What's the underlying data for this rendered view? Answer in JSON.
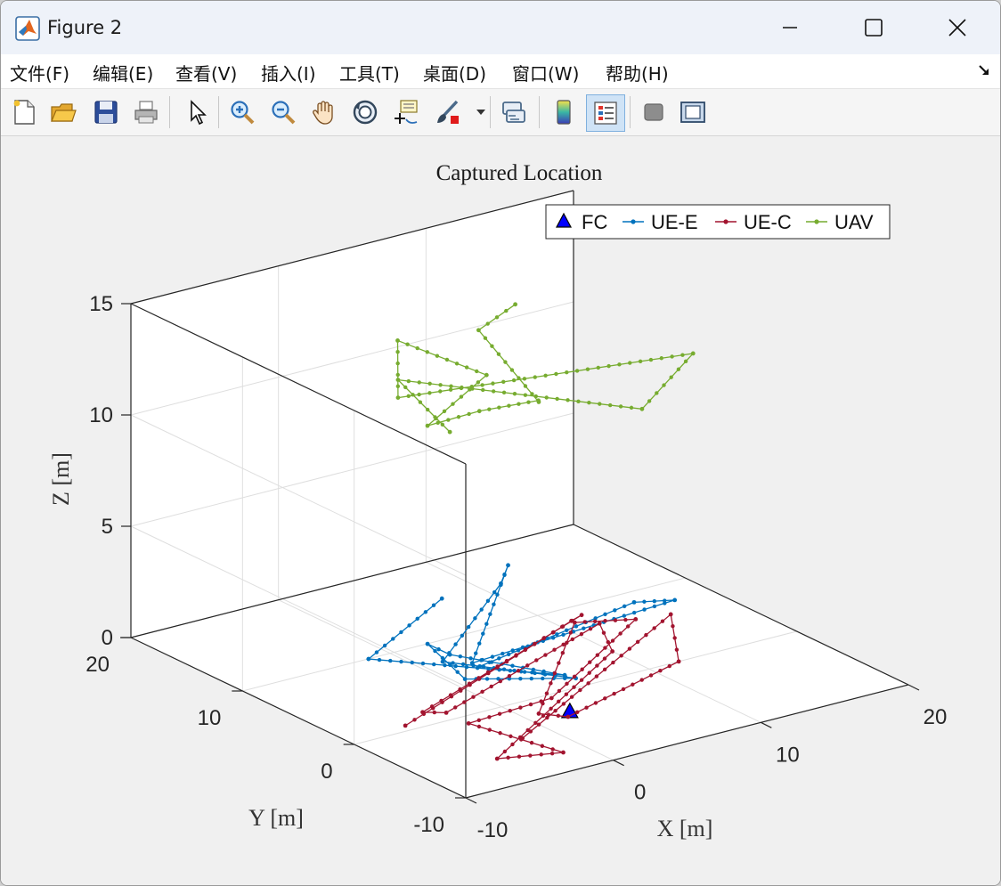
{
  "window": {
    "title": "Figure 2",
    "controls": [
      "minimize",
      "maximize",
      "close"
    ]
  },
  "menu": {
    "items": [
      "文件(F)",
      "编辑(E)",
      "查看(V)",
      "插入(I)",
      "工具(T)",
      "桌面(D)",
      "窗口(W)",
      "帮助(H)"
    ]
  },
  "toolbar": {
    "buttons": [
      "new-figure-icon",
      "open-icon",
      "save-icon",
      "print-icon",
      "pointer-icon",
      "zoom-in-icon",
      "zoom-out-icon",
      "pan-hand-icon",
      "rotate-3d-icon",
      "data-cursor-icon",
      "brush-icon",
      "link-plot-icon",
      "colorbar-icon",
      "legend-icon",
      "hide-plot-tools-icon",
      "show-plot-tools-icon"
    ],
    "active": "legend-icon"
  },
  "chart_data": {
    "type": "line",
    "projection": "3d",
    "title": "Captured Location",
    "xlabel": "X [m]",
    "ylabel": "Y [m]",
    "zlabel": "Z [m]",
    "xlim": [
      -10,
      20
    ],
    "ylim": [
      -10,
      20
    ],
    "zlim": [
      0,
      15
    ],
    "xticks": [
      -10,
      0,
      10,
      20
    ],
    "yticks": [
      -10,
      0,
      10,
      20
    ],
    "zticks": [
      0,
      5,
      10,
      15
    ],
    "grid": true,
    "legend_position": "top-right",
    "series": [
      {
        "name": "FC",
        "color": "#0000ff",
        "marker": "triangle",
        "line": false,
        "points": [
          [
            2.5,
            -2.8,
            0
          ]
        ]
      },
      {
        "name": "UE-E",
        "color": "#0072bd",
        "marker": "dot",
        "line": true,
        "points": [
          [
            2,
            8,
            2.6
          ],
          [
            -6,
            4,
            2.2
          ],
          [
            2,
            -3,
            1.8
          ],
          [
            -2,
            2,
            2.2
          ],
          [
            -2,
            4,
            2.2
          ],
          [
            -4,
            -2,
            2.4
          ],
          [
            2,
            -4,
            1.9
          ],
          [
            -4,
            0,
            2.7
          ],
          [
            6,
            8,
            2.6
          ],
          [
            8,
            10,
            2.6
          ],
          [
            -2,
            0,
            2.3
          ],
          [
            14,
            3,
            1.7
          ],
          [
            12,
            4,
            1.7
          ],
          [
            -3,
            -2,
            2.8
          ]
        ]
      },
      {
        "name": "UE-C",
        "color": "#a2142f",
        "marker": "dot",
        "line": true,
        "points": [
          [
            -6,
            0.7,
            0
          ],
          [
            11,
            8.3,
            0
          ],
          [
            12,
            8.7,
            0
          ],
          [
            -4,
            1.8,
            0
          ],
          [
            -3,
            1,
            0
          ],
          [
            12,
            7.1,
            0
          ],
          [
            10,
            3.3,
            0
          ],
          [
            -5,
            -6.2,
            0
          ],
          [
            -1.5,
            -7.5,
            0
          ],
          [
            -3,
            -1,
            0
          ],
          [
            3,
            -0.5,
            0
          ],
          [
            14,
            6.5,
            0
          ],
          [
            11,
            8,
            0
          ],
          [
            1,
            -2,
            0
          ],
          [
            2,
            -3.3,
            0
          ],
          [
            12,
            0,
            0
          ],
          [
            16,
            6,
            0
          ],
          [
            -2,
            -4.5,
            0
          ]
        ]
      },
      {
        "name": "UAV",
        "color": "#77ac30",
        "marker": "dot",
        "line": true,
        "points": [
          [
            -2,
            2,
            12.2
          ],
          [
            -4,
            4,
            14.4
          ],
          [
            8,
            -2,
            12.5
          ],
          [
            16,
            4,
            12.2
          ],
          [
            -4,
            4,
            13.6
          ],
          [
            -1,
            8,
            14.7
          ],
          [
            2,
            4,
            13.6
          ],
          [
            -2,
            4,
            12
          ],
          [
            0,
            2,
            12.8
          ],
          [
            4,
            2,
            12.6
          ],
          [
            1,
            -2,
            14
          ],
          [
            6,
            10,
            13.5
          ],
          [
            10,
            12,
            13.5
          ]
        ]
      }
    ]
  }
}
